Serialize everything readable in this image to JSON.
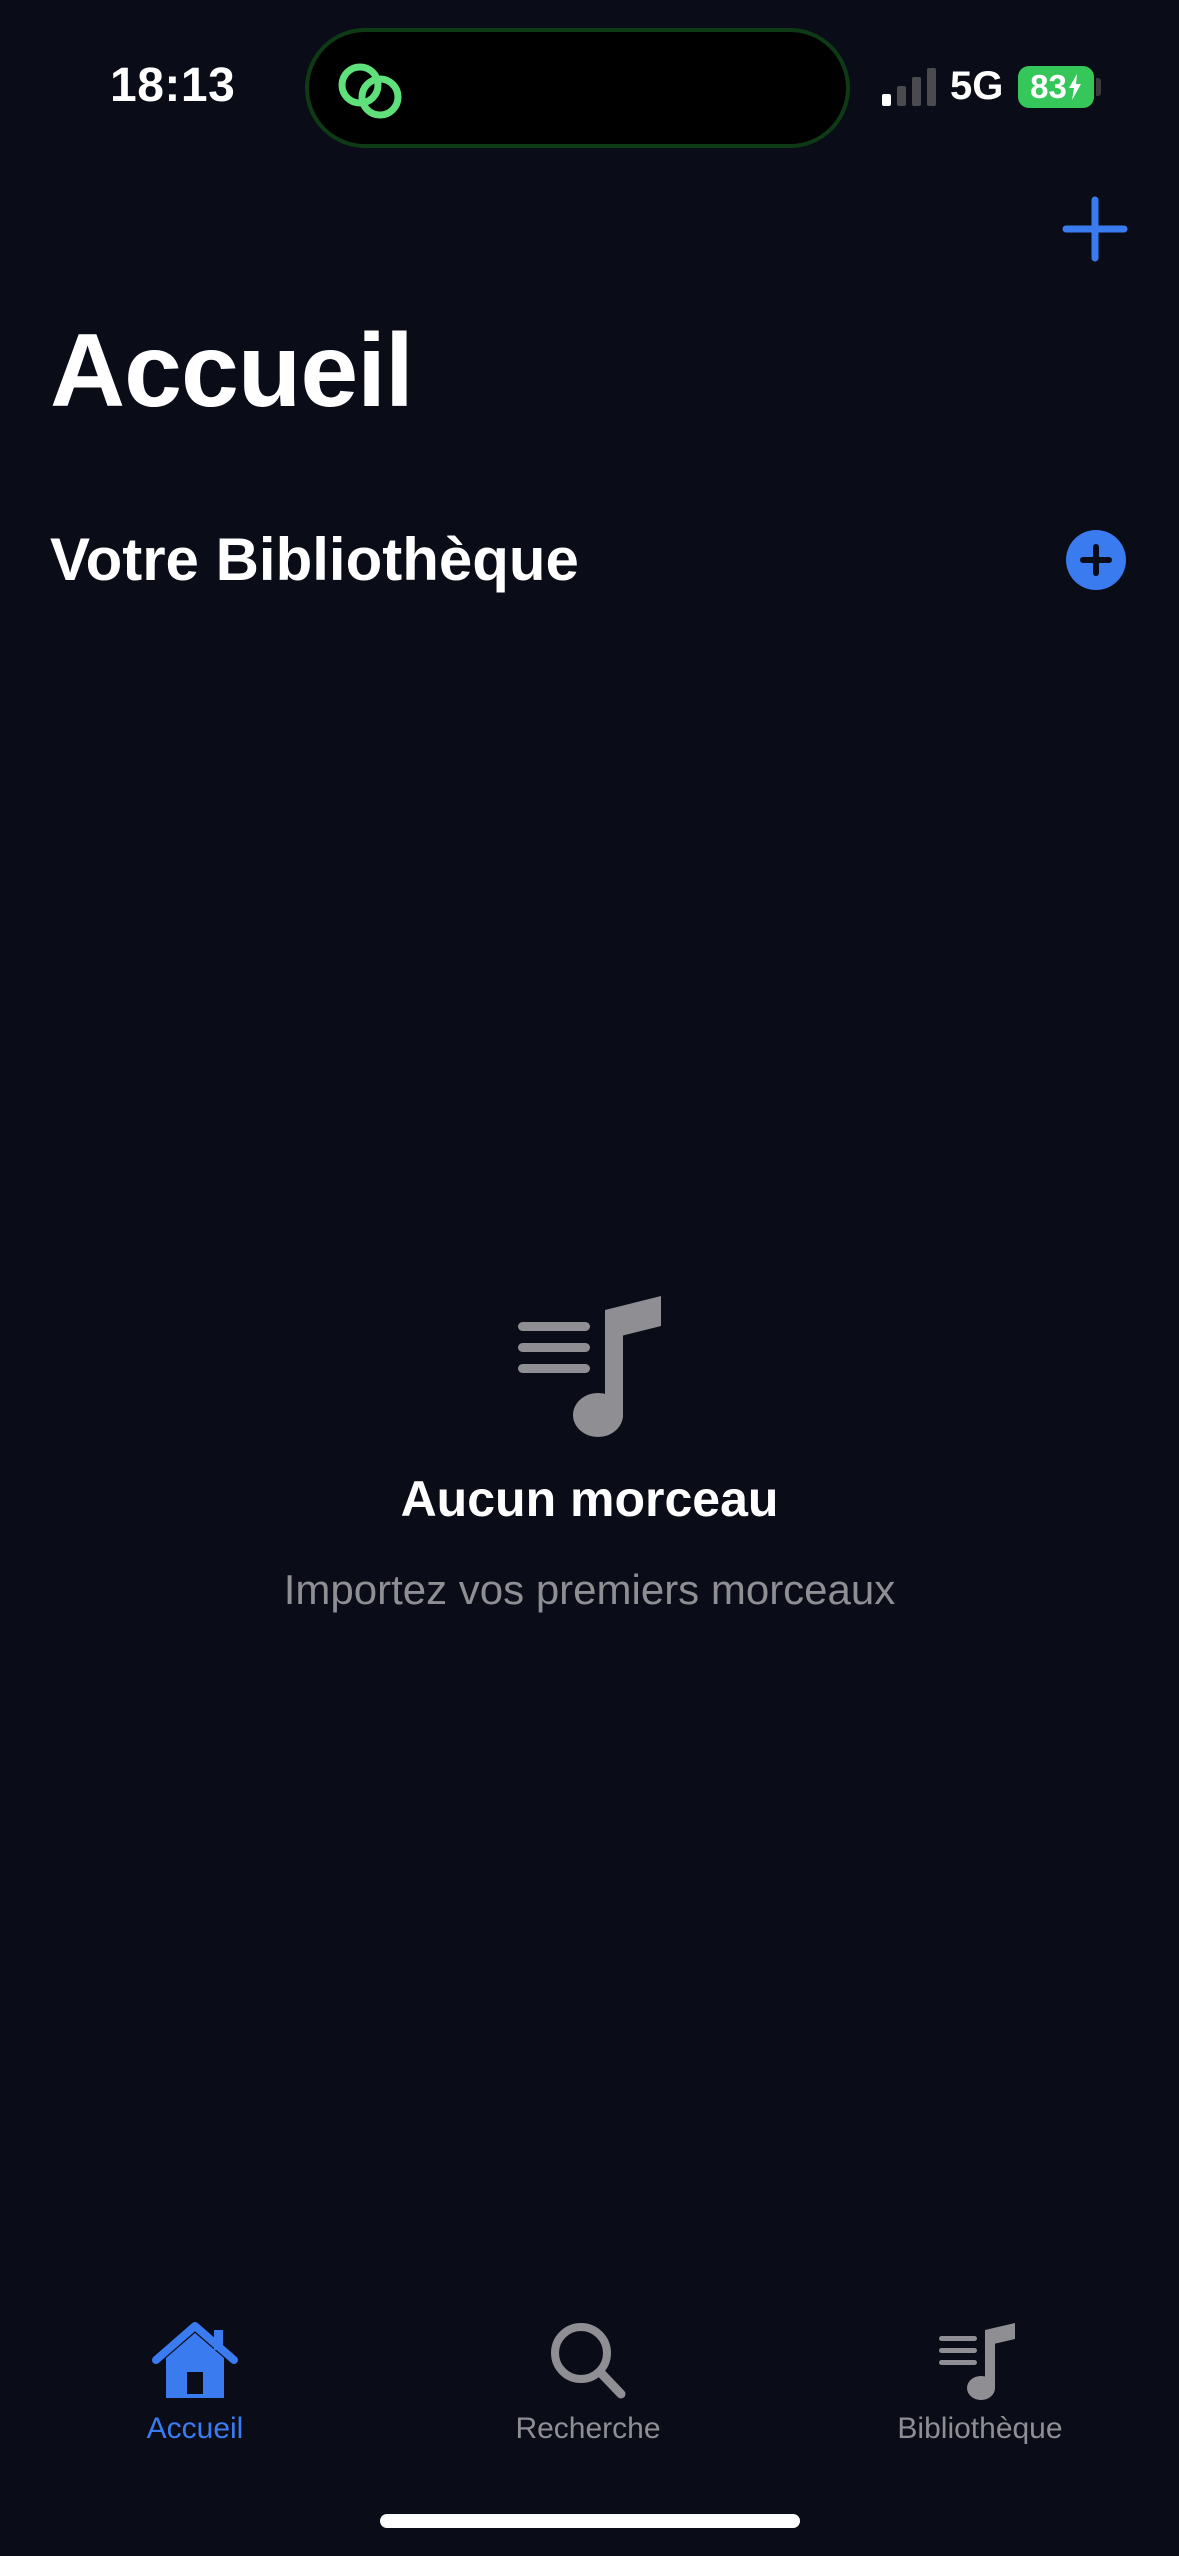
{
  "status_bar": {
    "time": "18:13",
    "network": "5G",
    "battery_level": "83",
    "battery_charging": true
  },
  "header": {
    "title": "Accueil",
    "add_icon": "plus-icon"
  },
  "library_section": {
    "title": "Votre Bibliothèque",
    "add_icon": "plus-circle-icon"
  },
  "empty_state": {
    "icon": "music-list-icon",
    "title": "Aucun morceau",
    "subtitle": "Importez vos premiers morceaux"
  },
  "tab_bar": {
    "tabs": [
      {
        "label": "Accueil",
        "icon": "house-icon",
        "active": true
      },
      {
        "label": "Recherche",
        "icon": "magnifier-icon",
        "active": false
      },
      {
        "label": "Bibliothèque",
        "icon": "music-list-icon",
        "active": false
      }
    ]
  },
  "colors": {
    "background": "#0a0c18",
    "accent": "#3a7bf0",
    "secondary_text": "#8e8e93",
    "battery": "#35c759",
    "island_icon": "#5fe07a"
  }
}
